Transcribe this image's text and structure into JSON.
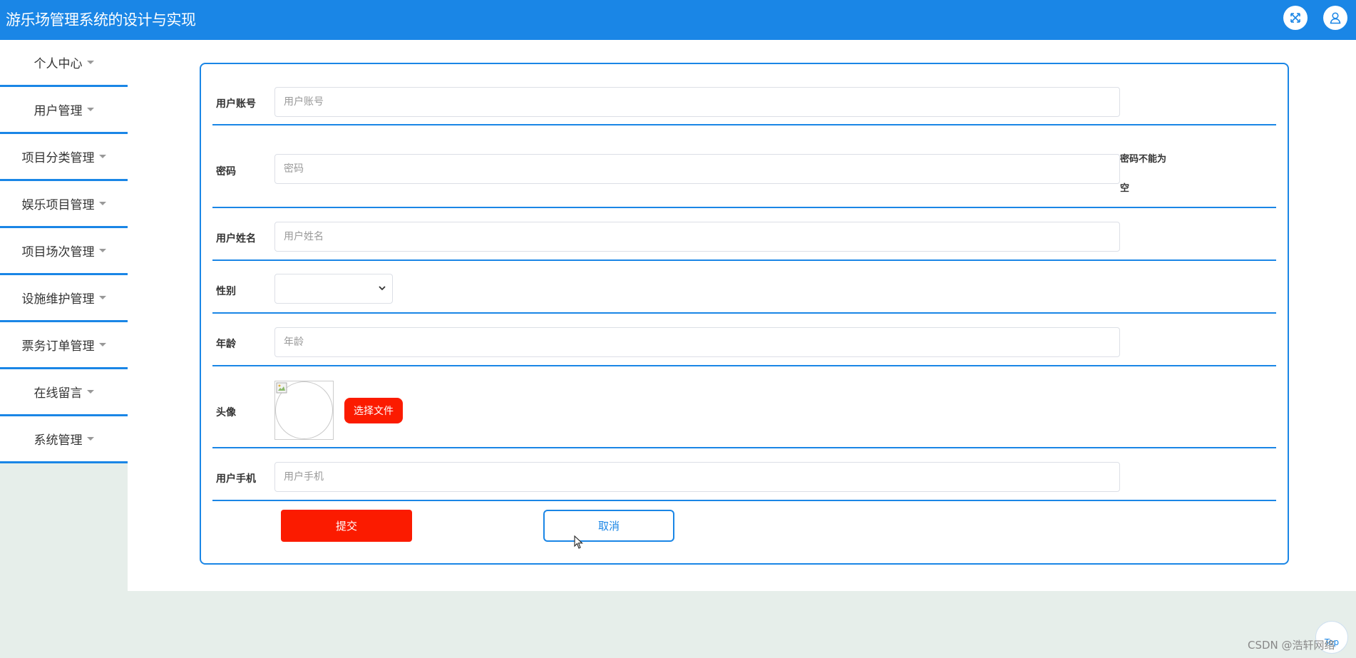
{
  "app": {
    "title": "游乐场管理系统的设计与实现",
    "accent_color": "#1a86e6",
    "danger_color": "#fb1b00"
  },
  "header": {
    "fullscreen_icon": "expand-icon",
    "user_icon": "user-icon"
  },
  "sidebar": {
    "items": [
      {
        "label": "个人中心"
      },
      {
        "label": "用户管理"
      },
      {
        "label": "项目分类管理"
      },
      {
        "label": "娱乐项目管理"
      },
      {
        "label": "项目场次管理"
      },
      {
        "label": "设施维护管理"
      },
      {
        "label": "票务订单管理"
      },
      {
        "label": "在线留言"
      },
      {
        "label": "系统管理"
      }
    ]
  },
  "form": {
    "account": {
      "label": "用户账号",
      "placeholder": "用户账号",
      "value": ""
    },
    "password": {
      "label": "密码",
      "placeholder": "密码",
      "value": "",
      "error_line1": "密码不能为",
      "error_line2": "空"
    },
    "name": {
      "label": "用户姓名",
      "placeholder": "用户姓名",
      "value": ""
    },
    "gender": {
      "label": "性别",
      "selected": ""
    },
    "age": {
      "label": "年龄",
      "placeholder": "年龄",
      "value": ""
    },
    "avatar": {
      "label": "头像",
      "button": "选择文件"
    },
    "phone": {
      "label": "用户手机",
      "placeholder": "用户手机",
      "value": ""
    },
    "submit": "提交",
    "cancel": "取消"
  },
  "footer": {
    "top_button": "Top",
    "watermark": "CSDN @浩轩网络"
  }
}
